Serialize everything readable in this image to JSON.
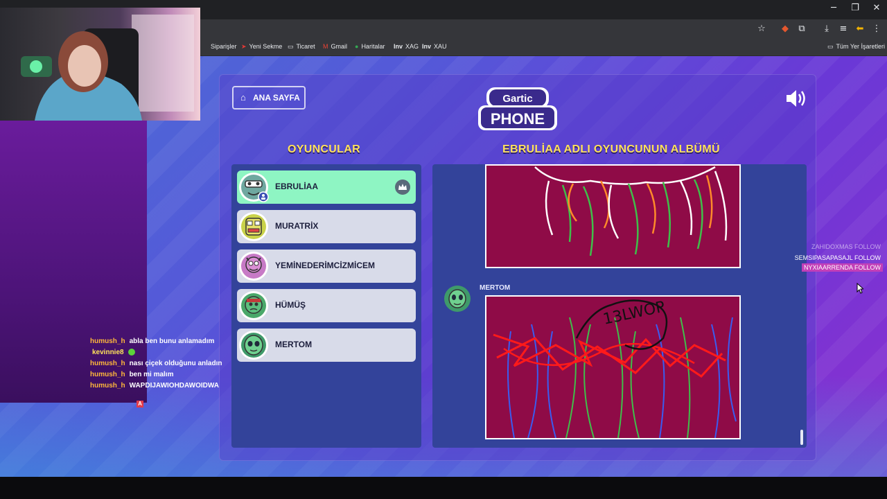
{
  "browser": {
    "bookmarks": [
      {
        "label": "Siparişler",
        "icon": "orders-icon"
      },
      {
        "label": "Yeni Sekme",
        "icon": "arrow-icon"
      },
      {
        "label": "Ticaret",
        "icon": "folder-icon"
      },
      {
        "label": "Gmail",
        "icon": "gmail-icon"
      },
      {
        "label": "Haritalar",
        "icon": "maps-icon"
      },
      {
        "label": "XAG",
        "icon": "investing-icon"
      },
      {
        "label": "XAU",
        "icon": "investing-icon"
      }
    ],
    "all_bookmarks_label": "Tüm Yer İşaretleri"
  },
  "chat": {
    "messages": [
      {
        "user": "humush_h",
        "text": "abla ben bunu anlamadım"
      },
      {
        "user": "kevinnie8",
        "text": ""
      },
      {
        "user": "humush_h",
        "text": "nası çiçek olduğunu anladın"
      },
      {
        "user": "humush_h",
        "text": "ben mi malım"
      },
      {
        "user": "humush_h",
        "text": "WAPDIJAWIOHDAWOIDWA"
      }
    ]
  },
  "follow_alerts": [
    {
      "name": "ZAHIDOXMAS",
      "action": "FOLLOW"
    },
    {
      "name": "SEMSIPASAPASAJL",
      "action": "FOLLOW"
    },
    {
      "name": "NYXIAARRENDA",
      "action": "FOLLOW"
    }
  ],
  "game": {
    "home_button": "ANA SAYFA",
    "logo": {
      "top": "Gartic",
      "bottom": "PHONE"
    },
    "players_heading": "OYUNCULAR",
    "album_heading": "EBRULİAA ADLI OYUNCUNUN ALBÜMÜ",
    "players": [
      {
        "name": "EBRULİAA",
        "host": true,
        "active": true
      },
      {
        "name": "MURATRİX",
        "host": false,
        "active": false
      },
      {
        "name": "YEMİNEDERİMCİZMİCEM",
        "host": false,
        "active": false
      },
      {
        "name": "HÜMÜŞ",
        "host": false,
        "active": false
      },
      {
        "name": "MERTOM",
        "host": false,
        "active": false
      }
    ],
    "album": {
      "entries": [
        {
          "author": "",
          "type": "drawing"
        },
        {
          "author": "MERTOM",
          "type": "drawing",
          "scribble_text": "13LWOP"
        }
      ]
    }
  }
}
